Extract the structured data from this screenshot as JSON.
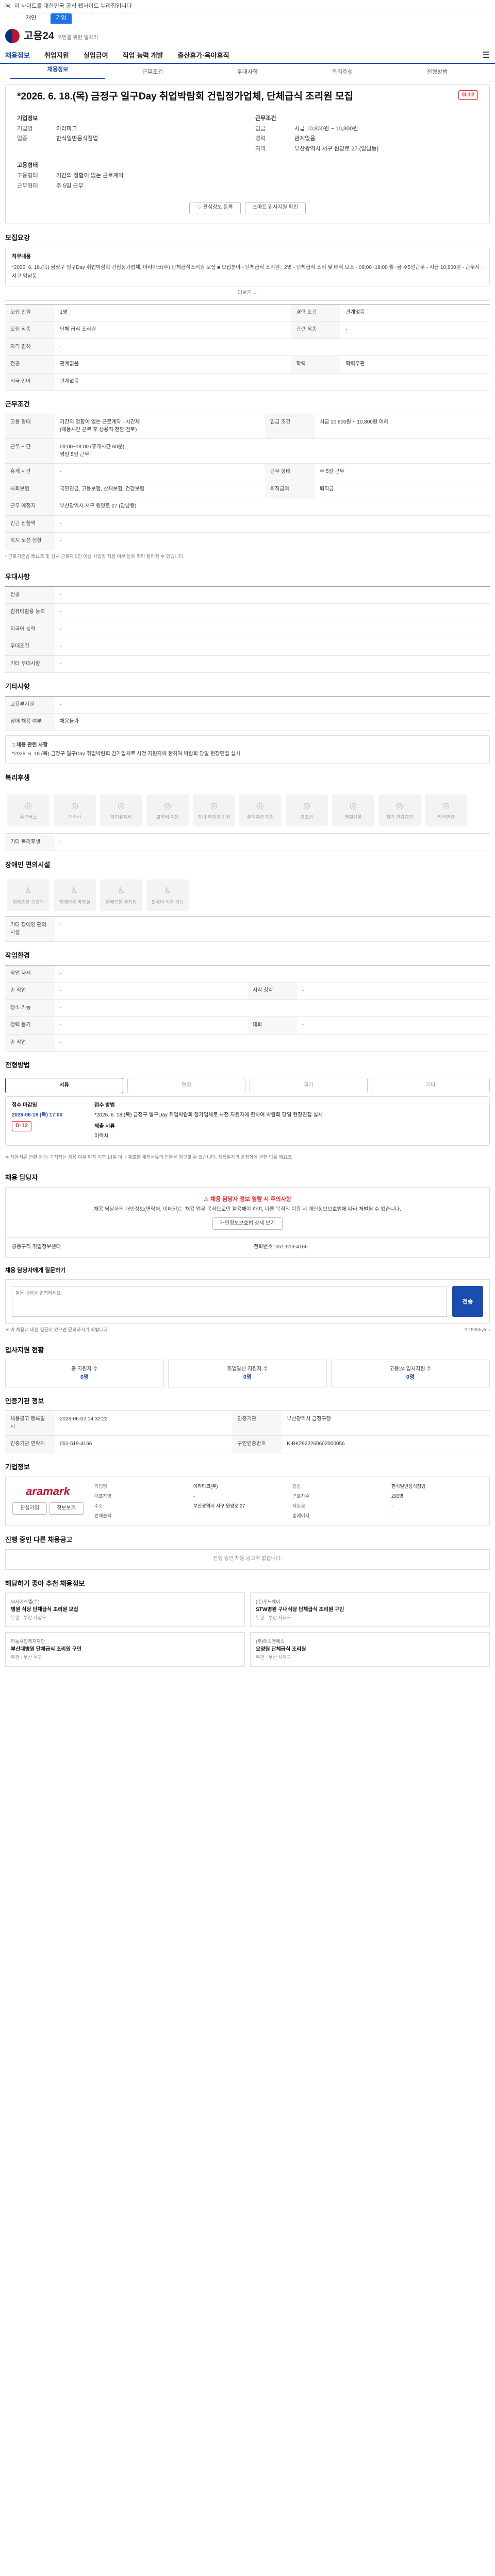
{
  "browser": {
    "notice": "이 사이트를 대한민국 공식 웹사이트 누리집입니다",
    "tab_a": "개인",
    "tab_b": "기업"
  },
  "header": {
    "logo": "고용24",
    "logo_sub": "국민을 위한 일자리",
    "menu_icon": "menu-icon"
  },
  "gnb": [
    "채용정보",
    "취업지원",
    "실업급여",
    "직업 능력 개발",
    "출산휴가·육아휴직"
  ],
  "subtabs": [
    "채용정보",
    "근무조건",
    "우대사항",
    "복리후생",
    "전형방법"
  ],
  "job": {
    "title": "*2026. 6. 18.(목) 금정구 일구Day 취업박람회 건립정가업체, 단체급식 조리원 모집",
    "dday": "D-12",
    "company_h": "기업정보",
    "company_name_k": "기업명",
    "company_name": "아라마크",
    "industry_k": "업종",
    "industry": "한식일반음식점업",
    "cond_h": "근무조건",
    "salary_k": "임금",
    "salary": "시급 10,800원 ~ 10,800원",
    "career_k": "경력",
    "career": "관계없음",
    "region_k": "지역",
    "region": "부산광역시 서구 원양로 27 (암남동)",
    "edu_h": "고용형태",
    "emp_type_k": "고용형태",
    "emp_type": "기간의 정함이 없는 근로계약",
    "hours_k": "근무형태",
    "hours": "주 5일 근무",
    "apply_btn": "관심정보 등록",
    "ask_btn": "스마트 입사지원 확인"
  },
  "detail": {
    "h": "모집요강",
    "desc_title": "직무내용",
    "desc": "*2026. 6. 18.(목) 금정구 일구Day 취업박람회 건립정가업체, 아라마크(주) 단체급식조리원 모집 ■ 모집분야 - 단체급식 조리원 : 2명 - 단체급식 조리 및 배식 보조 - 09:00~18:00 월~금 주5일근무 - 시급 10,800원 - 근무지 : 서구 암남동",
    "more": "더보기",
    "rows": [
      [
        "모집 인원",
        "1명",
        "경력 조건",
        "관계없음"
      ],
      [
        "모집 직종",
        "단체 급식 조리원",
        "관련 직종",
        "-"
      ],
      [
        "자격 면허",
        "-",
        "",
        ""
      ],
      [
        "전공",
        "관계없음",
        "학력",
        "학력무관"
      ],
      [
        "외국 언어",
        "관계없음",
        "",
        ""
      ]
    ]
  },
  "work": {
    "h": "근무조건",
    "rows": [
      [
        "고용 형태",
        "기간의 정함이 없는 근로계약 · 시간제\n(채용시간 근로 후 상용직 전환 검토)",
        "임금 조건",
        "시급 10,800원 ~ 10,800원 이하"
      ],
      [
        "근무 시간",
        "09:00~18:00 (휴게시간 60분)\n평일 5일 근무",
        "",
        ""
      ],
      [
        "휴게 시간",
        "-",
        "근무 형태",
        "주 5일 근무"
      ],
      [
        "사회보험",
        "국민연금, 고용보험, 산재보험, 건강보험",
        "퇴직급여",
        "퇴직금"
      ],
      [
        "근무 예정지",
        "부산광역시 서구 원양로 27 (암남동)",
        "",
        ""
      ],
      [
        "인근 전철역",
        "-",
        "",
        ""
      ],
      [
        "복지 노선 현황",
        "-",
        "",
        ""
      ]
    ],
    "note": "* 근로기준법 제11조 및 상시 근로자 5인 이상 사업장 적용 여부 등에 따라 달라질 수 있습니다.",
    "map_btn": "지도 보기"
  },
  "pref": {
    "h": "우대사항",
    "rows": [
      [
        "전공",
        "-"
      ],
      [
        "컴퓨터활용 능력",
        "-"
      ],
      [
        "외국어 능력",
        "-"
      ],
      [
        "우대조건",
        "-"
      ],
      [
        "기타 우대사항",
        "-"
      ]
    ]
  },
  "etc": {
    "h": "기타사항",
    "rows": [
      [
        "고용부지원",
        "-"
      ],
      [
        "장애 채용 여부",
        "채용불가"
      ]
    ],
    "notice_h": "□ 채용 관련 사항",
    "notice": "*2026. 6. 18.(목) 금정구 일구Day 취업박람회 참가업체로 사전 지원자에 한하여 박람회 당일 현장면접 실시"
  },
  "welfare": {
    "h": "복리후생",
    "items": [
      "통근버스",
      "기숙사",
      "차량유지비",
      "교육비 지원",
      "자녀 학자금 지원",
      "주택자금 지원",
      "경조금",
      "명절선물",
      "정기 건강검진",
      "퇴직연금"
    ],
    "other_k": "기타 복리후생",
    "other_v": "-"
  },
  "facility": {
    "h": "장애인 편의시설",
    "items": [
      "장애인용 승강기",
      "장애인용 화장실",
      "장애인용 주차장",
      "휠체어 이동 가능"
    ],
    "other_k": "기타 장애인 편의시설",
    "other_v": "-"
  },
  "env": {
    "h": "작업환경",
    "rows": [
      [
        "작업 자세",
        "-",
        "",
        ""
      ],
      [
        "손 작업",
        "-",
        "시각 청각",
        "-"
      ],
      [
        "청소 기능",
        "-",
        "",
        ""
      ],
      [
        "청력 듣기",
        "-",
        "대화",
        "-"
      ],
      [
        "손 작업",
        "-",
        "",
        ""
      ]
    ]
  },
  "method": {
    "h": "전형방법",
    "tabs": [
      "서류",
      "면접",
      "필기",
      "기타"
    ],
    "period_k": "접수 마감일",
    "period_v": "2026-06-18 (목) 17:00",
    "dday": "D-12",
    "method_k": "접수 방법",
    "method_v": "*2026. 6. 18.(목) 금정구 일구Day 취업박람회 참가업체로 사전 지원자에 한하여 박람회 당일 현장면접 실시",
    "docs_k": "제출 서류",
    "docs_v": "이력서",
    "notes": "※ 채용서류 반환 청구: 구직자는 채용 여부 확정 이후 14일 이내 제출한 채용서류의 반환을 청구할 수 있습니다. 채용절차의 공정화에 관한 법률 제11조"
  },
  "manager": {
    "h": "채용 담당자",
    "warn": "채용 담당자 정보 열람 시 주의사항",
    "body": "채용 담당자의 개인정보(연락처, 이메일)는 채용 업무 목적으로만 활용해야 하며, 다른 목적의 이용 시 개인정보보호법에 따라 처벌될 수 있습니다.",
    "view_btn": "개인정보보호법 상세 보기",
    "name_k": "공동구직 취업정보센터",
    "phone_k": "전화번호",
    "phone": "051-519-4166",
    "inq_h": "채용 담당자에게 질문하기",
    "inq_placeholder": "질문 내용을 입력하세요.",
    "inq_count": "0 / 500bytes",
    "submit": "전송",
    "inq_note": "※ 이 채용에 대한 질문이 있으면 문의하시기 바랍니다."
  },
  "stats": {
    "h": "입사지원 현황",
    "items": [
      [
        "총 지원자 수",
        "0명"
      ],
      [
        "취업알선 지원자 수",
        "0명"
      ],
      [
        "고용24 입사지원 수",
        "0명"
      ]
    ]
  },
  "reg": {
    "h": "인증기관 정보",
    "rows": [
      [
        "채용공고 등록일시",
        "2026-06-02 14:32:22",
        "인증기관",
        "부산광역시 금정구청"
      ],
      [
        "인증기관 연락처",
        "051-519-4166",
        "구인인증번호",
        "K-BK2922260602000056"
      ]
    ],
    "btn": "지도 보기"
  },
  "company": {
    "h": "기업정보",
    "brand": "aramark",
    "btn_a": "관심기업",
    "btn_b": "정보보기",
    "info": [
      [
        "기업명",
        "아라마크(주)"
      ],
      [
        "업종",
        "한식일반음식점업"
      ],
      [
        "대표자명",
        "-"
      ],
      [
        "근로자수",
        "295명"
      ],
      [
        "주소",
        "부산광역시 서구 원양로 27"
      ],
      [
        "자본금",
        "-"
      ],
      [
        "연매출액",
        "-"
      ],
      [
        "홈페이지",
        "-"
      ]
    ]
  },
  "others": {
    "h": "진행 중인 다른 채용공고",
    "empty": "진행 중인 채용 공고가 없습니다."
  },
  "recs": {
    "h": "해당하기 좋아 추천 채용정보",
    "items": [
      {
        "co": "씨지에스엘(주)",
        "title": "병원 식당 단체급식 조리원 모집",
        "meta": "무관 · 부산 사상구"
      },
      {
        "co": "(주)푸드웨어",
        "title": "STW병원 구내식당 단체급식 조리원 구인",
        "meta": "무관 · 부산 사하구"
      },
      {
        "co": "하늘사랑복지재단",
        "title": "부산대병원 단체급식 조리원 구인",
        "meta": "무관 · 부산 서구"
      },
      {
        "co": "(주)에스앤에스",
        "title": "요양원 단체급식 조리원",
        "meta": "무관 · 부산 사하구"
      }
    ]
  }
}
